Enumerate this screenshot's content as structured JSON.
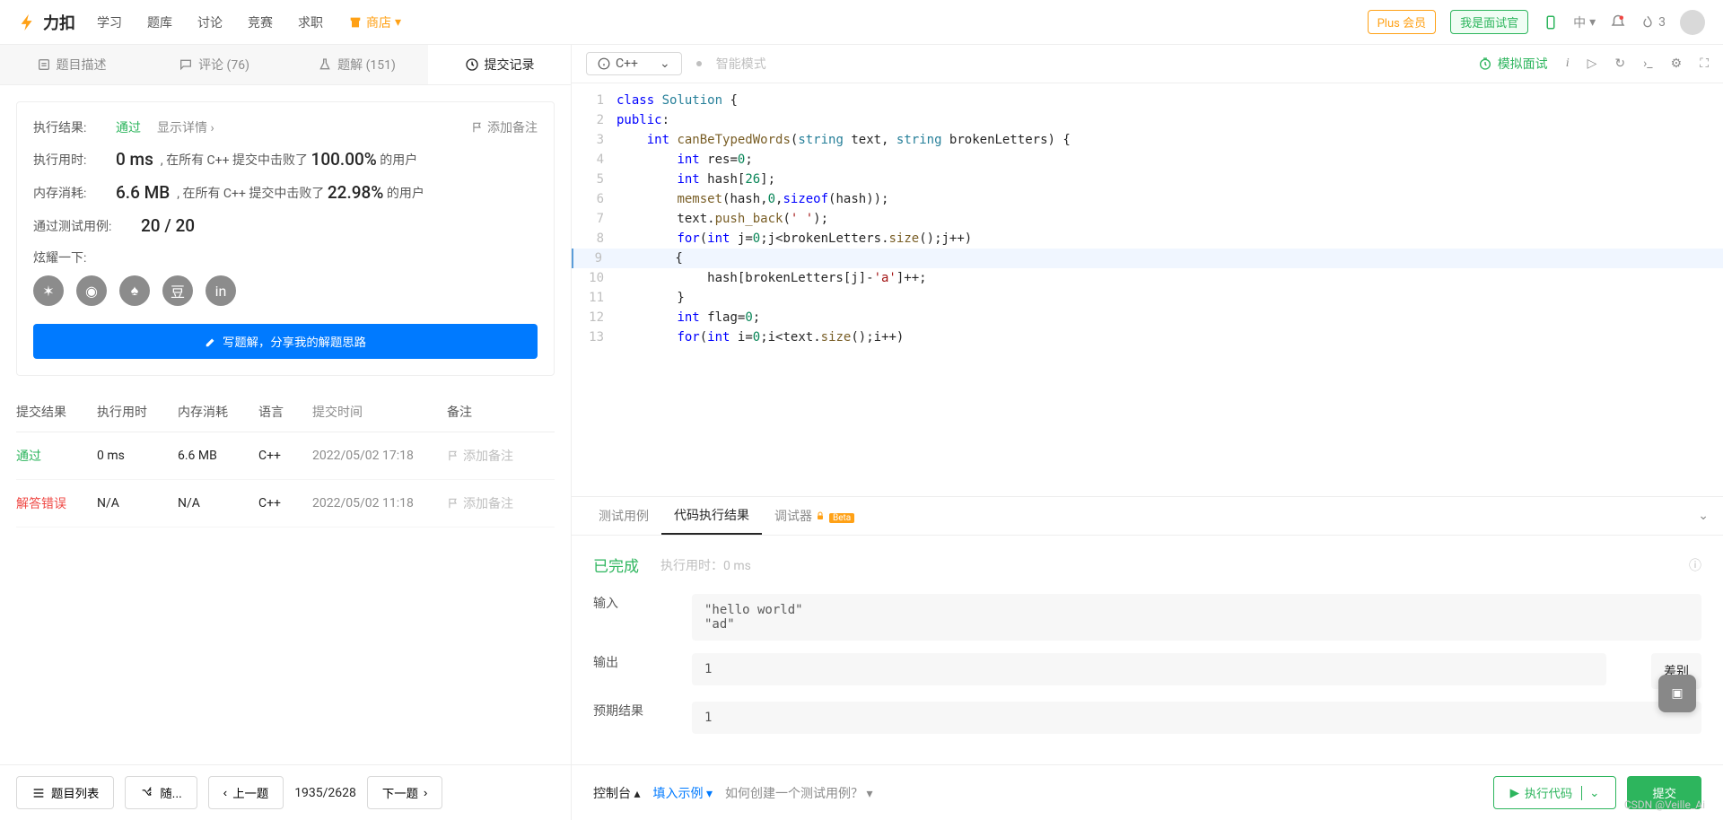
{
  "header": {
    "brand": "力扣",
    "nav": {
      "learn": "学习",
      "problems": "题库",
      "discuss": "讨论",
      "contest": "竞赛",
      "career": "求职",
      "store": "商店"
    },
    "plus": "Plus 会员",
    "interviewer": "我是面试官",
    "lang_ui": "中",
    "fire": "3"
  },
  "tabs": {
    "description": "题目描述",
    "comments": "评论 (76)",
    "solutions": "题解 (151)",
    "submissions": "提交记录"
  },
  "result": {
    "exec_result_label": "执行结果:",
    "pass": "通过",
    "show_detail": "显示详情",
    "add_note": "添加备注",
    "exec_time_label": "执行用时:",
    "exec_time": "0 ms",
    "exec_time_desc1": ", 在所有 C++ 提交中击败了",
    "exec_time_beat": "100.00%",
    "exec_time_desc2": "的用户",
    "mem_label": "内存消耗:",
    "mem": "6.6 MB",
    "mem_desc1": ", 在所有 C++ 提交中击败了",
    "mem_beat": "22.98%",
    "mem_desc2": "的用户",
    "testcase_label": "通过测试用例:",
    "testcase": "20 / 20",
    "share_label": "炫耀一下:",
    "write_solution": "写题解，分享我的解题思路"
  },
  "table": {
    "head": {
      "result": "提交结果",
      "time": "执行用时",
      "mem": "内存消耗",
      "lang": "语言",
      "date": "提交时间",
      "note": "备注"
    },
    "rows": [
      {
        "result": "通过",
        "result_class": "status-pass",
        "time": "0 ms",
        "mem": "6.6 MB",
        "lang": "C++",
        "date": "2022/05/02 17:18",
        "note": "添加备注"
      },
      {
        "result": "解答错误",
        "result_class": "status-fail",
        "time": "N/A",
        "mem": "N/A",
        "lang": "C++",
        "date": "2022/05/02 11:18",
        "note": "添加备注"
      }
    ]
  },
  "bottom": {
    "list": "题目列表",
    "random": "随...",
    "prev": "上一题",
    "counter": "1935/2628",
    "next": "下一题"
  },
  "editor": {
    "language": "C++",
    "smart_mode": "智能模式",
    "mock": "模拟面试",
    "code_lines": [
      {
        "n": 1,
        "html": "<span class='kw'>class</span> <span class='type'>Solution</span> {"
      },
      {
        "n": 2,
        "html": "<span class='kw'>public</span>:"
      },
      {
        "n": 3,
        "html": "    <span class='kw'>int</span> <span class='fn'>canBeTypedWords</span>(<span class='type'>string</span> text, <span class='type'>string</span> brokenLetters) {"
      },
      {
        "n": 4,
        "html": "        <span class='kw'>int</span> res=<span class='num'>0</span>;"
      },
      {
        "n": 5,
        "html": "        <span class='kw'>int</span> hash[<span class='num'>26</span>];"
      },
      {
        "n": 6,
        "html": "        <span class='fn'>memset</span>(hash,<span class='num'>0</span>,<span class='kw'>sizeof</span>(hash));"
      },
      {
        "n": 7,
        "html": "        text.<span class='fn'>push_back</span>(<span class='str'>' '</span>);"
      },
      {
        "n": 8,
        "html": "        <span class='kw'>for</span>(<span class='kw'>int</span> j=<span class='num'>0</span>;j&lt;brokenLetters.<span class='fn'>size</span>();j++)"
      },
      {
        "n": 9,
        "html": "        {",
        "current": true
      },
      {
        "n": 10,
        "html": "            hash[brokenLetters[j]-<span class='str'>'a'</span>]++;"
      },
      {
        "n": 11,
        "html": "        }"
      },
      {
        "n": 12,
        "html": "        <span class='kw'>int</span> flag=<span class='num'>0</span>;"
      },
      {
        "n": 13,
        "html": "        <span class='kw'>for</span>(<span class='kw'>int</span> i=<span class='num'>0</span>;i&lt;text.<span class='fn'>size</span>();i++)"
      }
    ]
  },
  "console": {
    "tabs": {
      "testcase": "测试用例",
      "result": "代码执行结果",
      "debugger": "调试器",
      "beta": "Beta"
    },
    "done": "已完成",
    "exec_time": "执行用时：0 ms",
    "input_label": "输入",
    "input": "\"hello world\"\n\"ad\"",
    "output_label": "输出",
    "output": "1",
    "expected_label": "预期结果",
    "expected": "1",
    "diff": "差别",
    "footer": {
      "console": "控制台",
      "fill": "填入示例",
      "howto": "如何创建一个测试用例？",
      "run": "执行代码",
      "submit": "提交"
    }
  },
  "watermark": "CSDN @Veille_Ai"
}
